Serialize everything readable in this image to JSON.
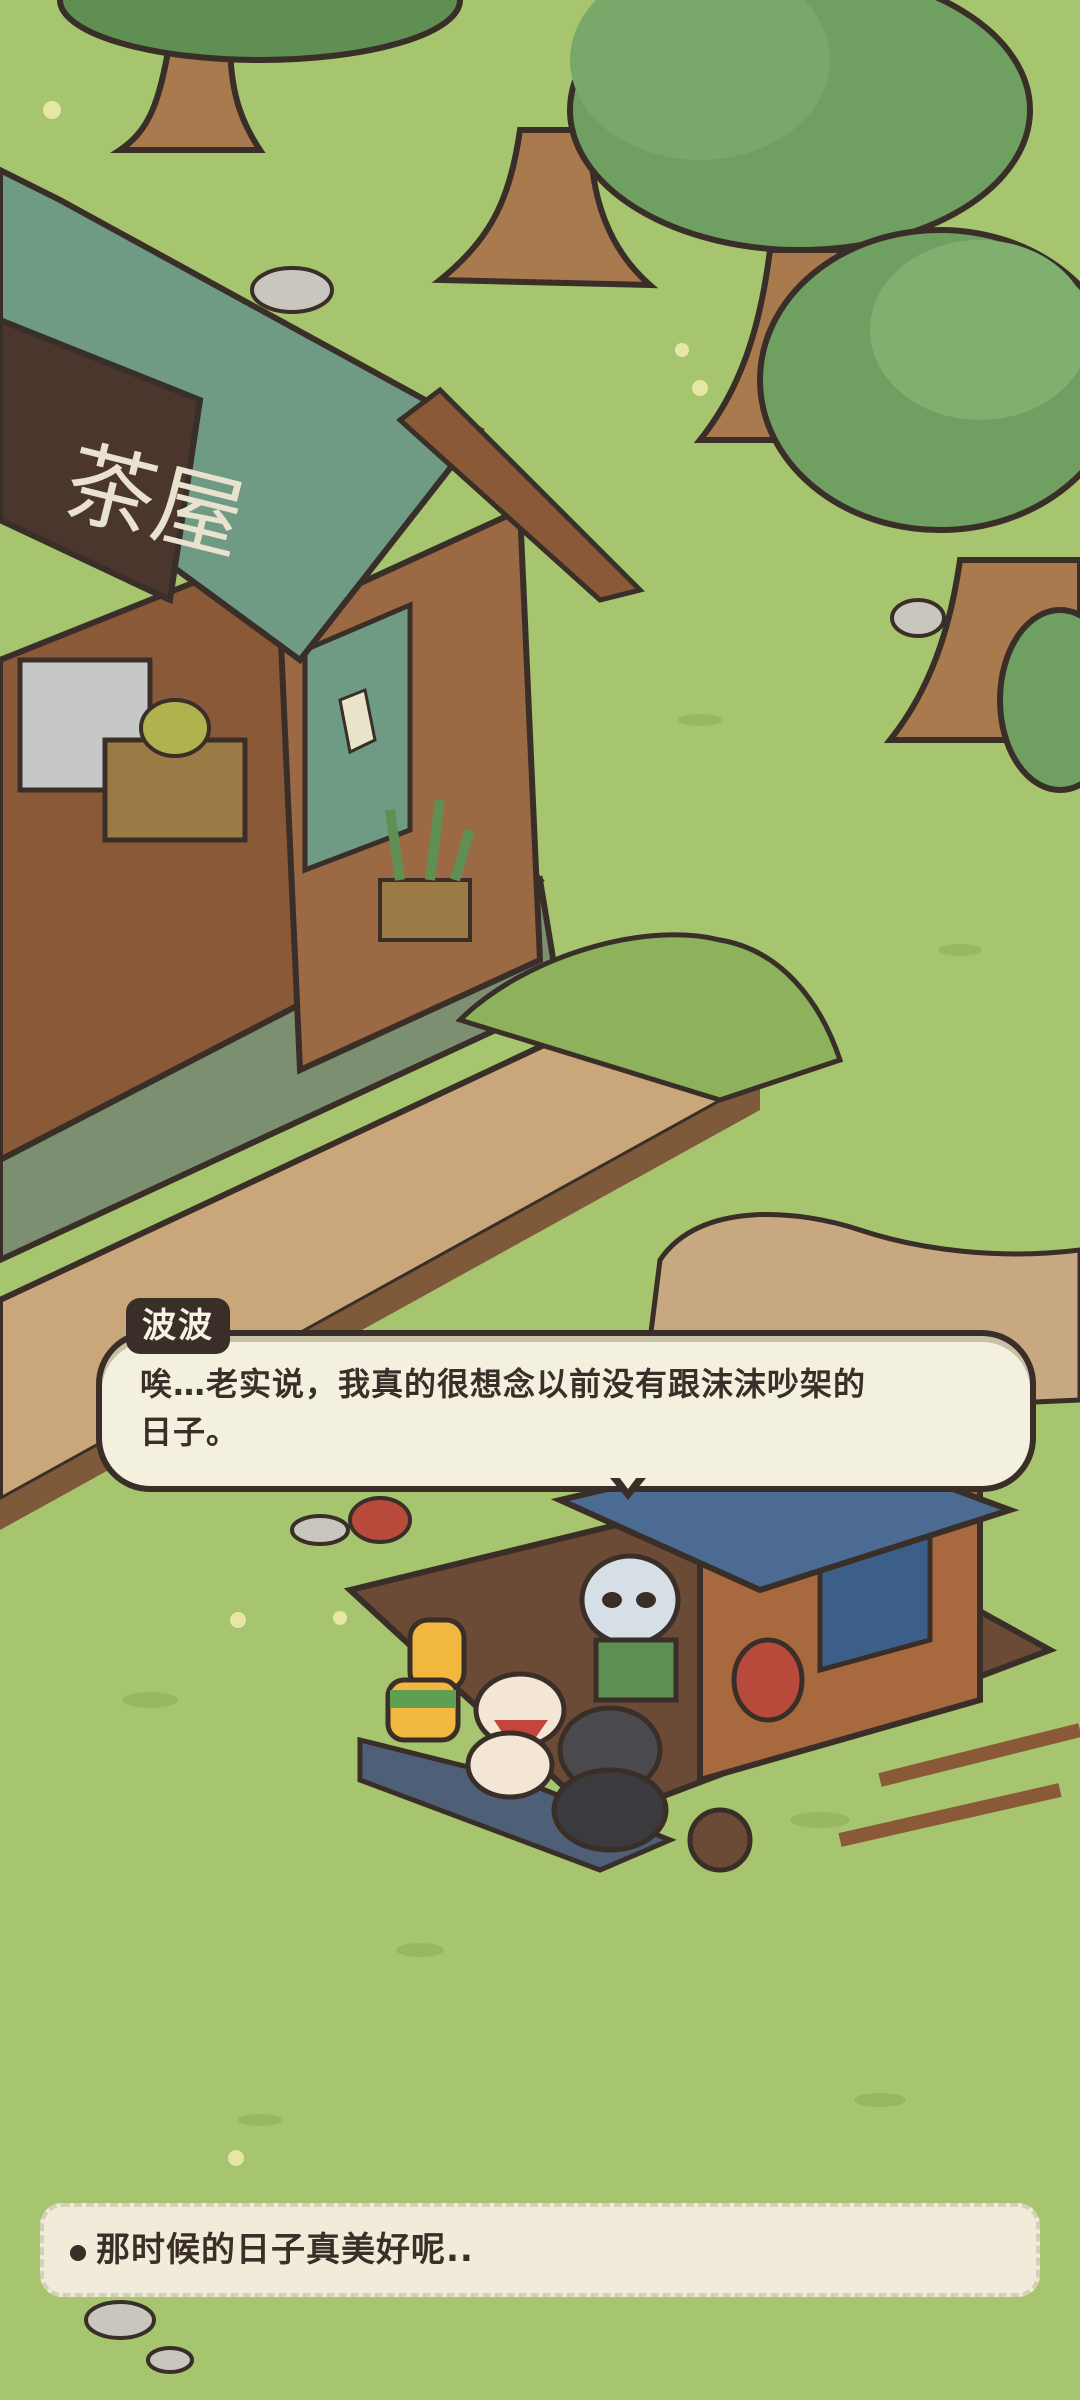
{
  "scene": {
    "shop_sign": "茶屋",
    "colors": {
      "grass": "#a7c46f",
      "roof": "#6f9a84",
      "wood": "#8a5a38",
      "outline": "#3a2e28",
      "bubble_bg": "#f3f0df"
    }
  },
  "dialogue": {
    "speaker": "波波",
    "lines": [
      "唉…老实说，我真的很想念以前没有跟沫沫吵架的",
      "日子。"
    ]
  },
  "choices": [
    {
      "label": "那时候的日子真美好呢.."
    }
  ]
}
